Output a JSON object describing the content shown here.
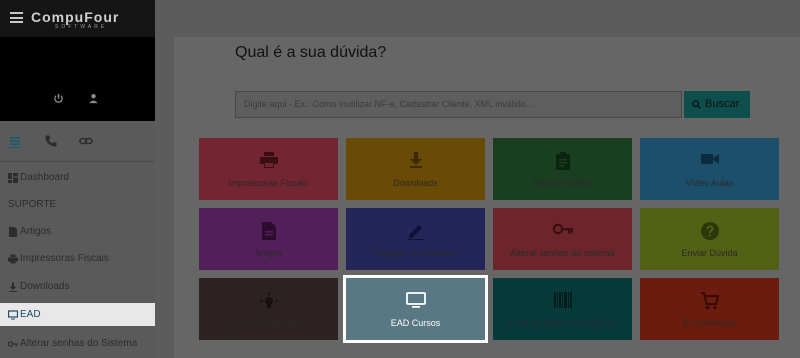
{
  "header": {
    "logo": "CompuFour",
    "logo_sub": "SOFTWARE"
  },
  "sidebar": {
    "items": [
      {
        "label": "Dashboard",
        "icon": "dashboard-icon"
      },
      {
        "label": "SUPORTE",
        "icon": ""
      },
      {
        "label": "Artigos",
        "icon": "article-icon"
      },
      {
        "label": "Impressoras Fiscais",
        "icon": "printer-icon"
      },
      {
        "label": "Downloads",
        "icon": "download-icon"
      },
      {
        "label": "EAD",
        "icon": "monitor-icon"
      },
      {
        "label": "Alterar senhas do Sistema",
        "icon": "key-icon"
      }
    ]
  },
  "main": {
    "title": "Qual é a sua dúvida?",
    "search_placeholder": "Digite aqui - Ex.: Como inutilizar NF-e, Cadastrar Cliente, XML inválido...",
    "search_button": "Buscar"
  },
  "tiles": [
    {
      "label": "Impressoras Fiscais",
      "icon": "printer-icon",
      "color": "#732531"
    },
    {
      "label": "Downloads",
      "icon": "download-icon",
      "color": "#6a4b05"
    },
    {
      "label": "Manual Online",
      "icon": "clipboard-icon",
      "color": "#1a3e20"
    },
    {
      "label": "Vídeo Aulas",
      "icon": "video-camera-icon",
      "color": "#1c4f6c"
    },
    {
      "label": "Artigos",
      "icon": "article-icon",
      "color": "#531f5a"
    },
    {
      "label": "Registro do Sistema",
      "icon": "pencil-icon",
      "color": "#242559"
    },
    {
      "label": "Alterar senhas do sistema",
      "icon": "key-icon",
      "color": "#6c262b"
    },
    {
      "label": "Enviar Dúvida",
      "icon": "question-icon",
      "color": "#536115"
    },
    {
      "label": "Enviar Sugestão",
      "icon": "lightbulb-icon",
      "color": "#2c2222"
    },
    {
      "label": "EAD Cursos",
      "icon": "monitor-icon",
      "color": "#5a7883"
    },
    {
      "label": "2ª Via do Boleto CompuFour",
      "icon": "barcode-icon",
      "color": "#06393a"
    },
    {
      "label": "E-Commerce",
      "icon": "cart-icon",
      "color": "#6b1c0e"
    }
  ]
}
